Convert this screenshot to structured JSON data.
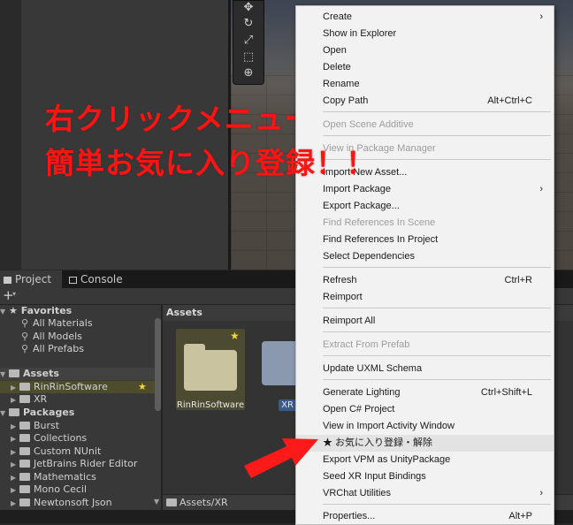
{
  "project_panel": {
    "tabs": [
      {
        "label": "Project"
      },
      {
        "label": "Console"
      }
    ],
    "add_button": "+",
    "tree": {
      "favorites": {
        "label": "Favorites",
        "items": [
          "All Materials",
          "All Models",
          "All Prefabs"
        ]
      },
      "assets": {
        "label": "Assets",
        "items": [
          {
            "label": "RinRinSoftware",
            "favorite": true
          },
          {
            "label": "XR"
          }
        ]
      },
      "packages": {
        "label": "Packages",
        "items": [
          "Burst",
          "Collections",
          "Custom NUnit",
          "JetBrains Rider Editor",
          "Mathematics",
          "Mono Cecil",
          "Newtonsoft Json"
        ]
      }
    },
    "main_header": "Assets",
    "assets": [
      {
        "label": "RinRinSoftware",
        "favorite": true
      },
      {
        "label": "XR"
      }
    ],
    "footer_path": "Assets/XR"
  },
  "context_menu": {
    "items": [
      {
        "label": "Create",
        "submenu": true
      },
      {
        "label": "Show in Explorer"
      },
      {
        "label": "Open"
      },
      {
        "label": "Delete"
      },
      {
        "label": "Rename"
      },
      {
        "label": "Copy Path",
        "shortcut": "Alt+Ctrl+C"
      },
      {
        "label": "Open Scene Additive",
        "disabled": true
      },
      {
        "label": "View in Package Manager",
        "disabled": true
      },
      {
        "label": "Import New Asset..."
      },
      {
        "label": "Import Package",
        "submenu": true
      },
      {
        "label": "Export Package..."
      },
      {
        "label": "Find References In Scene",
        "disabled": true
      },
      {
        "label": "Find References In Project"
      },
      {
        "label": "Select Dependencies"
      },
      {
        "label": "Refresh",
        "shortcut": "Ctrl+R"
      },
      {
        "label": "Reimport"
      },
      {
        "label": "Reimport All"
      },
      {
        "label": "Extract From Prefab",
        "disabled": true
      },
      {
        "label": "Update UXML Schema"
      },
      {
        "label": "Generate Lighting",
        "shortcut": "Ctrl+Shift+L"
      },
      {
        "label": "Open C# Project"
      },
      {
        "label": "View in Import Activity Window"
      },
      {
        "label": "★ お気に入り登録・解除",
        "highlighted": true
      },
      {
        "label": "Export VPM as UnityPackage"
      },
      {
        "label": "Seed XR Input Bindings"
      },
      {
        "label": "VRChat Utilities",
        "submenu": true
      },
      {
        "label": "Properties...",
        "shortcut": "Alt+P"
      }
    ]
  },
  "overlay": {
    "line1": "右クリックメニューで",
    "line2": "簡単お気に入り登録！！",
    "color": "#ff1414"
  },
  "colors": {
    "accent_star": "#f3d33b",
    "selection": "#4d4d2e",
    "arrow": "#ff1a1a"
  }
}
